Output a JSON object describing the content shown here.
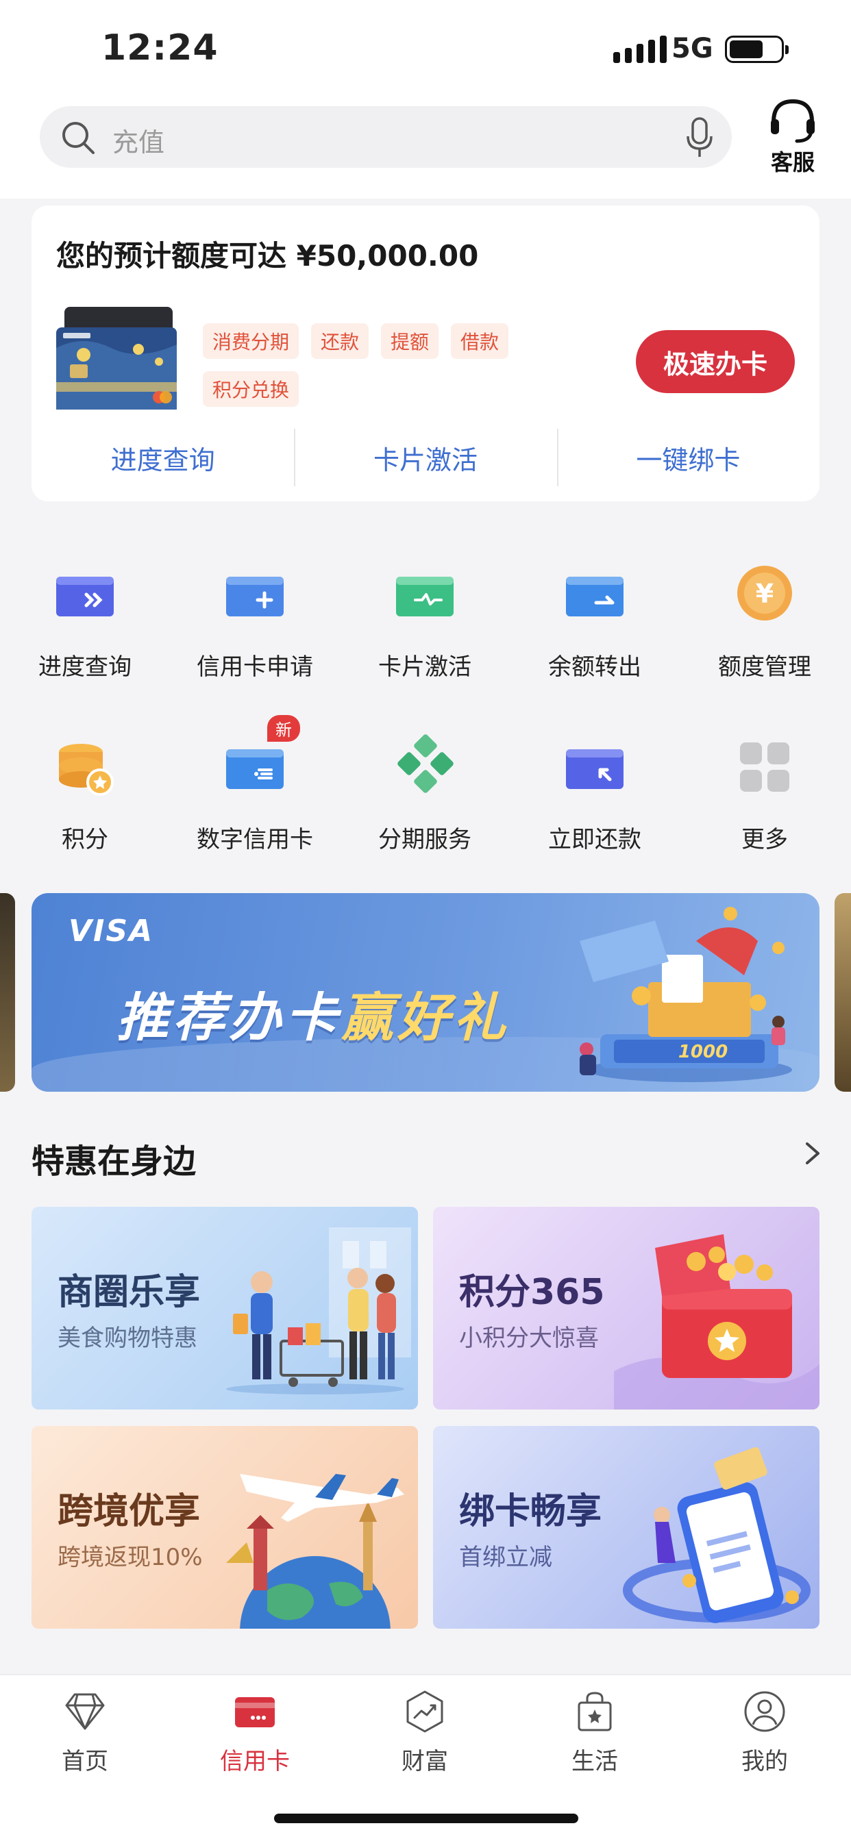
{
  "status_bar": {
    "time": "12:24",
    "network": "5G"
  },
  "search": {
    "placeholder": "充值"
  },
  "service": {
    "label": "客服"
  },
  "card_panel": {
    "limit_text": "您的预计额度可达 ¥50,000.00",
    "tags": [
      "消费分期",
      "还款",
      "提额",
      "借款",
      "积分兑换"
    ],
    "apply_button": "极速办卡",
    "quick_links": [
      "进度查询",
      "卡片激活",
      "一键绑卡"
    ]
  },
  "grid": {
    "row1": [
      {
        "label": "进度查询",
        "icon": "progress-card-icon"
      },
      {
        "label": "信用卡申请",
        "icon": "card-apply-icon"
      },
      {
        "label": "卡片激活",
        "icon": "card-activate-icon"
      },
      {
        "label": "余额转出",
        "icon": "balance-transfer-icon"
      },
      {
        "label": "额度管理",
        "icon": "limit-yuan-icon"
      }
    ],
    "row2": [
      {
        "label": "积分",
        "icon": "points-coin-stack-icon"
      },
      {
        "label": "数字信用卡",
        "icon": "digital-card-icon",
        "badge": "新"
      },
      {
        "label": "分期服务",
        "icon": "installment-diamond-icon"
      },
      {
        "label": "立即还款",
        "icon": "repay-card-icon"
      },
      {
        "label": "更多",
        "icon": "more-grid-icon"
      }
    ]
  },
  "banner": {
    "brand": "VISA",
    "title_main": "推荐办卡",
    "title_highlight": "赢好礼",
    "art_amount": "1000"
  },
  "section": {
    "title": "特惠在身边"
  },
  "promos": [
    {
      "title": "商圈乐享",
      "subtitle": "美食购物特惠"
    },
    {
      "title": "积分365",
      "subtitle": "小积分大惊喜"
    },
    {
      "title": "跨境优享",
      "subtitle": "跨境返现10%"
    },
    {
      "title": "绑卡畅享",
      "subtitle": "首绑立减"
    }
  ],
  "tabbar": [
    {
      "label": "首页",
      "icon": "diamond-icon",
      "active": false
    },
    {
      "label": "信用卡",
      "icon": "credit-card-icon",
      "active": true
    },
    {
      "label": "财富",
      "icon": "wealth-chart-icon",
      "active": false
    },
    {
      "label": "生活",
      "icon": "shopping-bag-icon",
      "active": false
    },
    {
      "label": "我的",
      "icon": "user-icon",
      "active": false
    }
  ],
  "colors": {
    "accent": "#d8323f",
    "link": "#3f6fd0",
    "tag_text": "#e0523a",
    "tag_bg": "#fdeee8"
  }
}
